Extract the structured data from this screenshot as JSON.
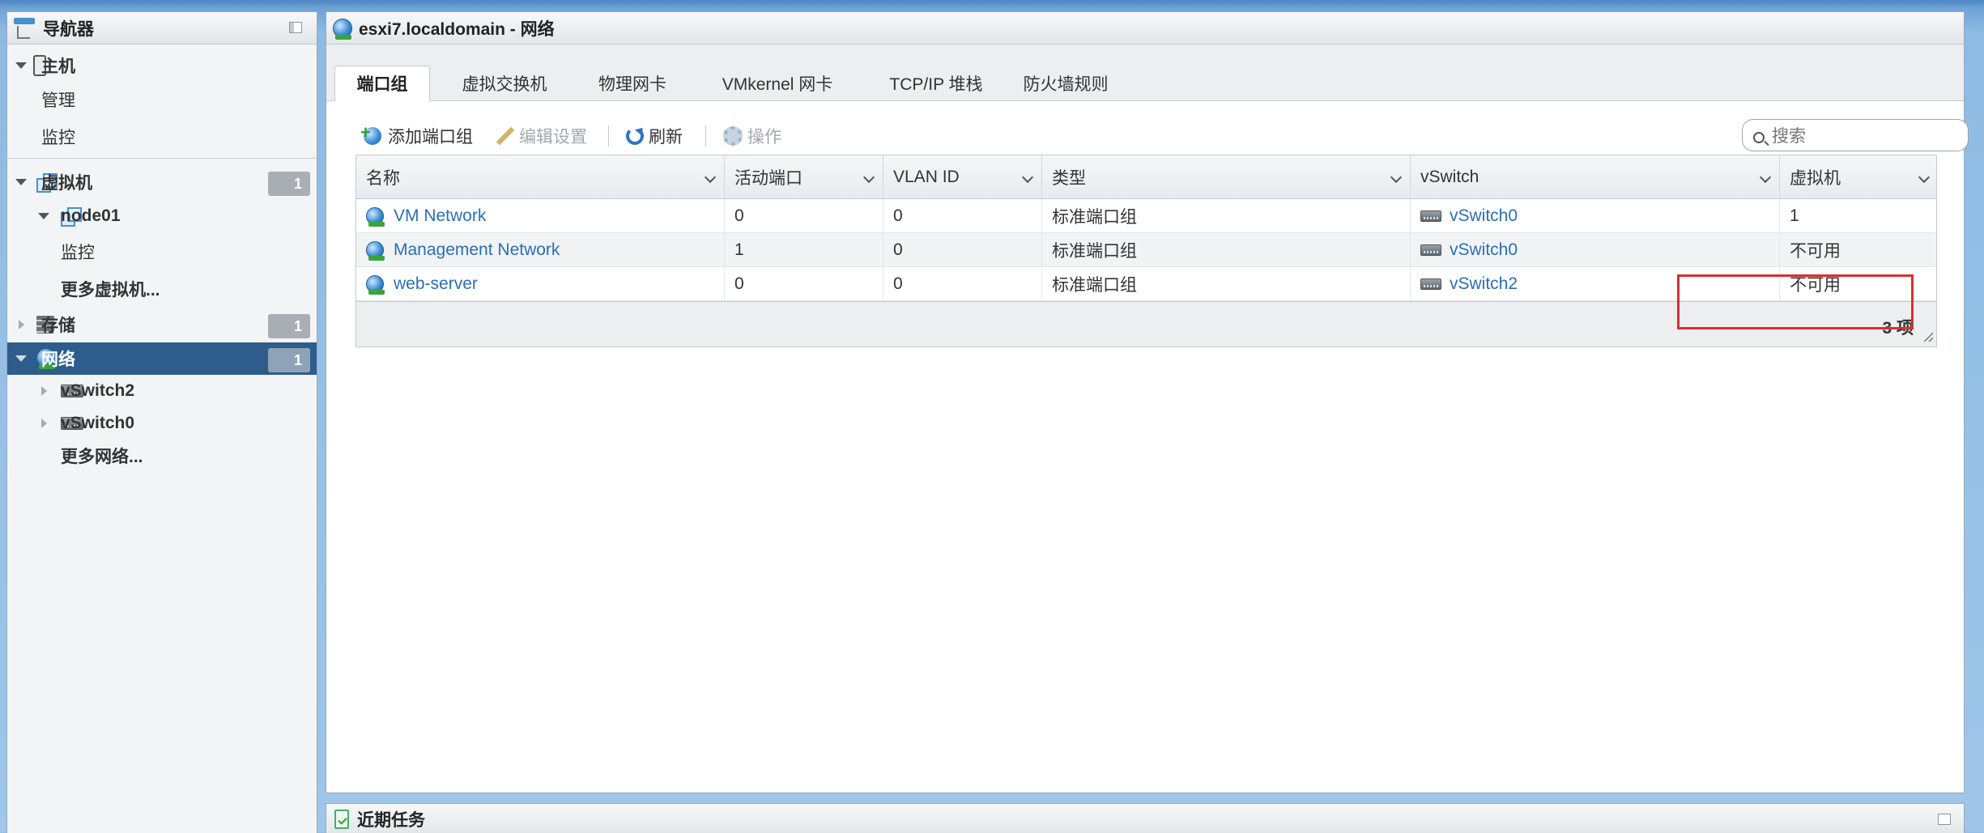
{
  "navigator": {
    "title": "导航器",
    "host": {
      "label": "主机",
      "children": [
        "管理",
        "监控"
      ]
    },
    "vms": {
      "label": "虚拟机",
      "badge": "1",
      "node": {
        "label": "node01",
        "children": [
          "监控"
        ]
      },
      "more": "更多虚拟机..."
    },
    "storage": {
      "label": "存储",
      "badge": "1"
    },
    "network": {
      "label": "网络",
      "badge": "1",
      "children": [
        "vSwitch2",
        "vSwitch0"
      ],
      "more": "更多网络..."
    }
  },
  "main": {
    "title": "esxi7.localdomain - 网络",
    "tabs": [
      "端口组",
      "虚拟交换机",
      "物理网卡",
      "VMkernel 网卡",
      "TCP/IP 堆栈",
      "防火墙规则"
    ],
    "active_tab": "端口组",
    "toolbar": {
      "add": "添加端口组",
      "edit": "编辑设置",
      "refresh": "刷新",
      "actions": "操作"
    },
    "search": {
      "placeholder": "搜索"
    },
    "grid": {
      "columns": [
        "名称",
        "活动端口",
        "VLAN ID",
        "类型",
        "vSwitch",
        "虚拟机"
      ],
      "rows": [
        [
          "VM Network",
          "0",
          "0",
          "标准端口组",
          "vSwitch0",
          "1"
        ],
        [
          "Management Network",
          "1",
          "0",
          "标准端口组",
          "vSwitch0",
          "不可用"
        ],
        [
          "web-server",
          "0",
          "0",
          "标准端口组",
          "vSwitch2",
          "不可用"
        ]
      ],
      "footer_count": "3 项"
    }
  },
  "tasks": {
    "title": "近期任务"
  },
  "colors": {
    "selected_bg": "#2e5d8c",
    "link": "#2a6fb5",
    "highlight": "#d83030"
  }
}
